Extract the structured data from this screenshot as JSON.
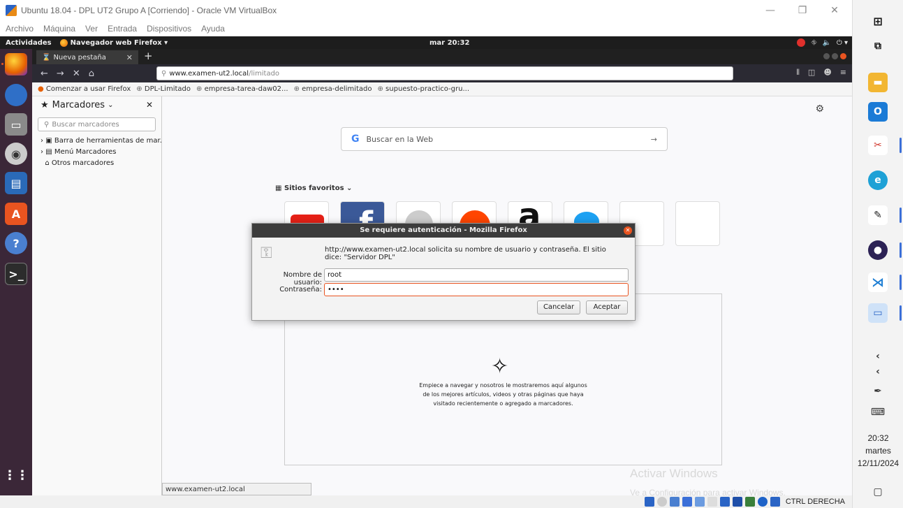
{
  "vbox": {
    "title": "Ubuntu 18.04 - DPL UT2 Grupo A [Corriendo] - Oracle VM VirtualBox",
    "menu": [
      "Archivo",
      "Máquina",
      "Ver",
      "Entrada",
      "Dispositivos",
      "Ayuda"
    ],
    "host_key": "CTRL DERECHA"
  },
  "topbar": {
    "activities": "Actividades",
    "app": "Navegador web Firefox ▾",
    "clock": "mar 20:32"
  },
  "firefox": {
    "tab_title": "Nueva pestaña",
    "url_host": "www.examen-ut2.local",
    "url_path": "/limitado",
    "bookmarks": [
      "Comenzar a usar Firefox",
      "DPL-Limitado",
      "empresa-tarea-daw02...",
      "empresa-delimitado",
      "supuesto-practico-gru..."
    ],
    "status_url": "www.examen-ut2.local"
  },
  "sidebar": {
    "title": "Marcadores",
    "search_placeholder": "Buscar marcadores",
    "items": [
      "Barra de herramientas de mar...",
      "Menú Marcadores",
      "Otros marcadores"
    ]
  },
  "newtab": {
    "search_label": "Buscar en la Web",
    "favorites_label": "Sitios favoritos",
    "story_line1": "Empiece a navegar y nosotros le mostraremos aquí algunos",
    "story_line2": "de los mejores artículos, videos y otras páginas que haya",
    "story_line3": "visitado recientemente o agregado a marcadores."
  },
  "dialog": {
    "title": "Se requiere autenticación - Mozilla Firefox",
    "message": "http://www.examen-ut2.local solicita su nombre de usuario y contraseña. El sitio dice: \"Servidor DPL\"",
    "user_label": "Nombre de usuario:",
    "user_value": "root",
    "pass_label": "Contraseña:",
    "pass_value": "••••",
    "cancel": "Cancelar",
    "accept": "Aceptar"
  },
  "watermark": {
    "line1": "Activar Windows",
    "line2": "Ve a Configuración para activar Windows."
  },
  "windows": {
    "time": "20:32",
    "day": "martes",
    "date": "12/11/2024"
  }
}
